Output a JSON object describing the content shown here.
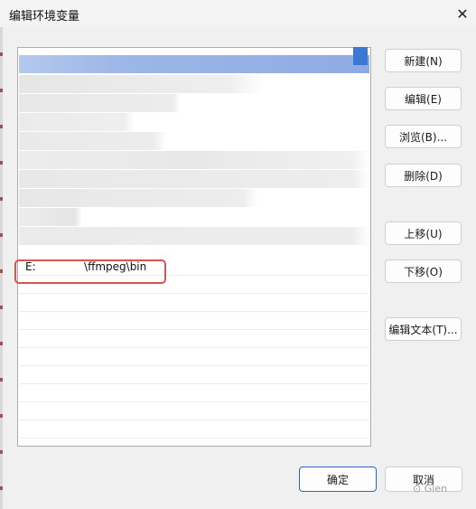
{
  "window": {
    "title": "编辑环境变量",
    "close_glyph": "✕"
  },
  "list": {
    "visible_entry": "E:              \\ffmpeg\\bin"
  },
  "buttons": {
    "new": "新建(N)",
    "edit": "编辑(E)",
    "browse": "浏览(B)...",
    "delete": "删除(D)",
    "move_up": "上移(U)",
    "move_down": "下移(O)",
    "edit_text": "编辑文本(T)...",
    "ok": "确定",
    "cancel": "取消"
  },
  "watermark": {
    "text": "Glen"
  },
  "colors": {
    "accent": "#2b63c9",
    "annotation": "#d9534f"
  }
}
